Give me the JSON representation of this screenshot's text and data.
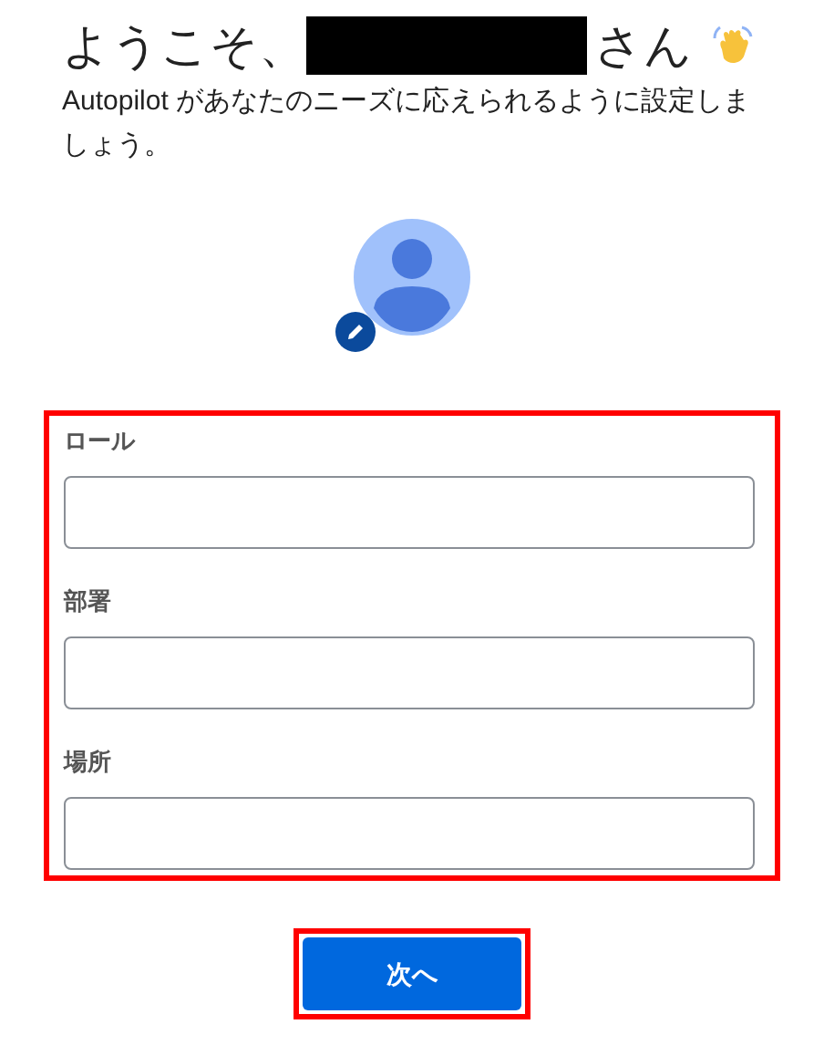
{
  "header": {
    "greeting": "ようこそ、",
    "name_redacted": true,
    "honorific": "さん",
    "subtitle": "Autopilot があなたのニーズに応えられるように設定しましょう。"
  },
  "form": {
    "highlighted": true,
    "fields": [
      {
        "label": "ロール"
      },
      {
        "label": "部署"
      },
      {
        "label": "場所"
      }
    ]
  },
  "next_button": {
    "label": "次へ",
    "highlighted": true
  }
}
